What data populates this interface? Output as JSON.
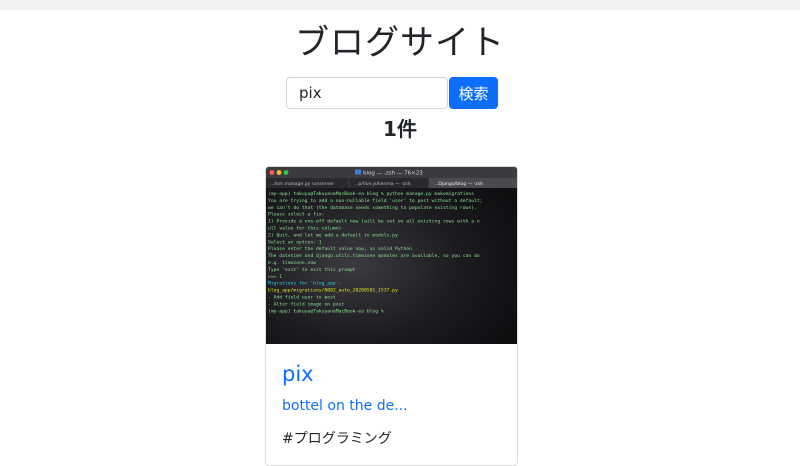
{
  "page": {
    "title": "ブログサイト"
  },
  "search": {
    "value": "pix",
    "button_label": "検索"
  },
  "results": {
    "count_label": "1件"
  },
  "card": {
    "title": "pix",
    "link_text": "bottel on the de...",
    "tag": "#プログラミング",
    "thumbnail": {
      "window_title": "blog — -zsh — 76×23",
      "tabs": [
        "...hon manage.py runserver",
        "...p/Vue.js/kenma — -zsh",
        "...Django/blog — -zsh"
      ],
      "lines": [
        {
          "color": "#8fe08f",
          "text": "(my-app) takuya@TakuyanoMacBook-ea blog % python manage.py makemigrations"
        },
        {
          "color": "#8fe08f",
          "text": "You are trying to add a non-nullable field 'user' to post without a default;"
        },
        {
          "color": "#8fe08f",
          "text": " we can't do that (the database needs something to populate existing rows)."
        },
        {
          "color": "#8fe08f",
          "text": "Please select a fix:"
        },
        {
          "color": "#8fe08f",
          "text": " 1) Provide a one-off default now (will be set on all existing rows with a n"
        },
        {
          "color": "#8fe08f",
          "text": "ull value for this column)"
        },
        {
          "color": "#8fe08f",
          "text": " 2) Quit, and let me add a default in models.py"
        },
        {
          "color": "#8fe08f",
          "text": "Select an option: 1"
        },
        {
          "color": "#8fe08f",
          "text": "Please enter the default value now, as valid Python"
        },
        {
          "color": "#8fe08f",
          "text": "The datetime and django.utils.timezone modules are available, so you can do"
        },
        {
          "color": "#8fe08f",
          "text": " e.g. timezone.now"
        },
        {
          "color": "#8fe08f",
          "text": "Type 'exit' to exit this prompt"
        },
        {
          "color": "#8fe08f",
          "text": ">>> 1"
        },
        {
          "color": "#2dd3e6",
          "text": "Migrations for 'blog_app':"
        },
        {
          "color": "#e6e620",
          "text": "  blog_app/migrations/0002_auto_20200501_1537.py"
        },
        {
          "color": "#8fe08f",
          "text": "    - Add field user to post"
        },
        {
          "color": "#8fe08f",
          "text": "    - Alter field image on post"
        },
        {
          "color": "#8fe08f",
          "text": "(my-app) takuya@TakuyanoMacBook-ea blog %"
        }
      ]
    }
  }
}
